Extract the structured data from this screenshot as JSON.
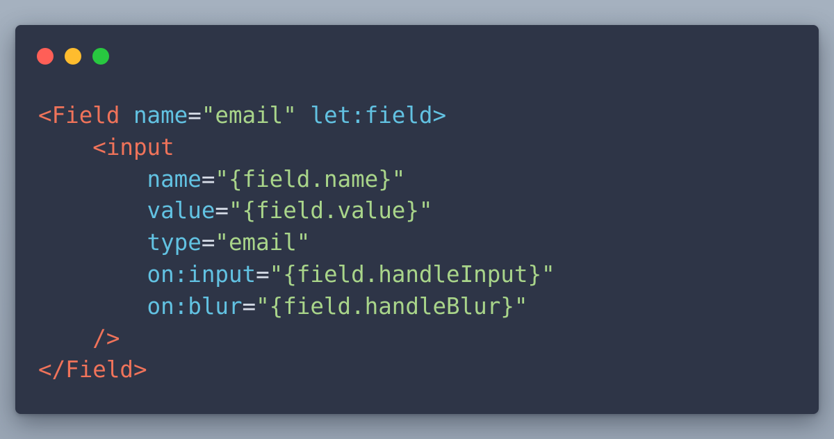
{
  "window": {
    "controls": [
      {
        "name": "close",
        "color": "#ff5f57"
      },
      {
        "name": "minimize",
        "color": "#febc2e"
      },
      {
        "name": "maximize",
        "color": "#28c840"
      }
    ]
  },
  "colors": {
    "tag": "#f0735a",
    "attribute": "#62c2e2",
    "equals": "#d8dee9",
    "string": "#a9d58a",
    "background": "#2e3547"
  },
  "code": {
    "lines": [
      {
        "tokens": [
          {
            "t": "<Field",
            "k": "tag"
          },
          {
            "t": " ",
            "k": "plain"
          },
          {
            "t": "name",
            "k": "attribute"
          },
          {
            "t": "=",
            "k": "equals"
          },
          {
            "t": "\"email\"",
            "k": "string"
          },
          {
            "t": " ",
            "k": "plain"
          },
          {
            "t": "let:field",
            "k": "attribute"
          },
          {
            "t": ">",
            "k": "attribute"
          }
        ]
      },
      {
        "tokens": [
          {
            "t": "    ",
            "k": "plain"
          },
          {
            "t": "<input",
            "k": "tag"
          }
        ]
      },
      {
        "tokens": [
          {
            "t": "        ",
            "k": "plain"
          },
          {
            "t": "name",
            "k": "attribute"
          },
          {
            "t": "=",
            "k": "equals"
          },
          {
            "t": "\"{field.name}\"",
            "k": "string"
          }
        ]
      },
      {
        "tokens": [
          {
            "t": "        ",
            "k": "plain"
          },
          {
            "t": "value",
            "k": "attribute"
          },
          {
            "t": "=",
            "k": "equals"
          },
          {
            "t": "\"{field.value}\"",
            "k": "string"
          }
        ]
      },
      {
        "tokens": [
          {
            "t": "        ",
            "k": "plain"
          },
          {
            "t": "type",
            "k": "attribute"
          },
          {
            "t": "=",
            "k": "equals"
          },
          {
            "t": "\"email\"",
            "k": "string"
          }
        ]
      },
      {
        "tokens": [
          {
            "t": "        ",
            "k": "plain"
          },
          {
            "t": "on:input",
            "k": "attribute"
          },
          {
            "t": "=",
            "k": "equals"
          },
          {
            "t": "\"{field.handleInput}\"",
            "k": "string"
          }
        ]
      },
      {
        "tokens": [
          {
            "t": "        ",
            "k": "plain"
          },
          {
            "t": "on:blur",
            "k": "attribute"
          },
          {
            "t": "=",
            "k": "equals"
          },
          {
            "t": "\"{field.handleBlur}\"",
            "k": "string"
          }
        ]
      },
      {
        "tokens": [
          {
            "t": "    ",
            "k": "plain"
          },
          {
            "t": "/>",
            "k": "tag"
          }
        ]
      },
      {
        "tokens": [
          {
            "t": "</Field>",
            "k": "tag"
          }
        ]
      }
    ]
  }
}
